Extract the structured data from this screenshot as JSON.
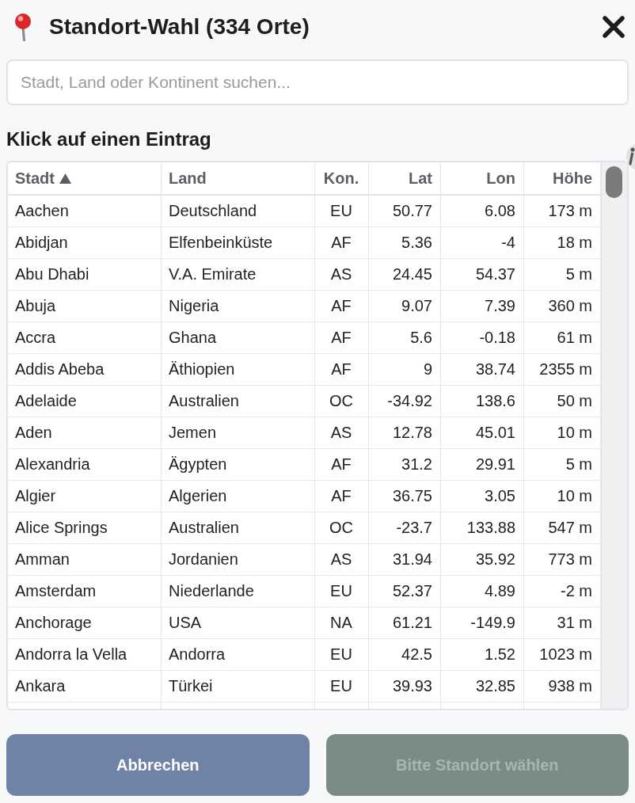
{
  "dialog": {
    "title": "Standort-Wahl (334 Orte)"
  },
  "search": {
    "placeholder": "Stadt, Land oder Kontinent suchen..."
  },
  "list_heading": "Klick auf einen Eintrag",
  "table": {
    "columns": [
      {
        "label": "Stadt",
        "kind": "text",
        "sorted": true
      },
      {
        "label": "Land",
        "kind": "text",
        "sorted": false
      },
      {
        "label": "Kon.",
        "kind": "code",
        "sorted": false
      },
      {
        "label": "Lat",
        "kind": "number",
        "sorted": false
      },
      {
        "label": "Lon",
        "kind": "number",
        "sorted": false
      },
      {
        "label": "Höhe",
        "kind": "number",
        "sorted": false
      }
    ],
    "rows": [
      [
        "Aachen",
        "Deutschland",
        "EU",
        "50.77",
        "6.08",
        "173 m"
      ],
      [
        "Abidjan",
        "Elfenbeinküste",
        "AF",
        "5.36",
        "-4",
        "18 m"
      ],
      [
        "Abu Dhabi",
        "V.A. Emirate",
        "AS",
        "24.45",
        "54.37",
        "5 m"
      ],
      [
        "Abuja",
        "Nigeria",
        "AF",
        "9.07",
        "7.39",
        "360 m"
      ],
      [
        "Accra",
        "Ghana",
        "AF",
        "5.6",
        "-0.18",
        "61 m"
      ],
      [
        "Addis Abeba",
        "Äthiopien",
        "AF",
        "9",
        "38.74",
        "2355 m"
      ],
      [
        "Adelaide",
        "Australien",
        "OC",
        "-34.92",
        "138.6",
        "50 m"
      ],
      [
        "Aden",
        "Jemen",
        "AS",
        "12.78",
        "45.01",
        "10 m"
      ],
      [
        "Alexandria",
        "Ägypten",
        "AF",
        "31.2",
        "29.91",
        "5 m"
      ],
      [
        "Algier",
        "Algerien",
        "AF",
        "36.75",
        "3.05",
        "10 m"
      ],
      [
        "Alice Springs",
        "Australien",
        "OC",
        "-23.7",
        "133.88",
        "547 m"
      ],
      [
        "Amman",
        "Jordanien",
        "AS",
        "31.94",
        "35.92",
        "773 m"
      ],
      [
        "Amsterdam",
        "Niederlande",
        "EU",
        "52.37",
        "4.89",
        "-2 m"
      ],
      [
        "Anchorage",
        "USA",
        "NA",
        "61.21",
        "-149.9",
        "31 m"
      ],
      [
        "Andorra la Vella",
        "Andorra",
        "EU",
        "42.5",
        "1.52",
        "1023 m"
      ],
      [
        "Ankara",
        "Türkei",
        "EU",
        "39.93",
        "32.85",
        "938 m"
      ]
    ]
  },
  "buttons": [
    {
      "label": "Abbrechen",
      "kind": "secondary",
      "disabled": false
    },
    {
      "label": "Bitte Standort wählen",
      "kind": "primary",
      "disabled": true
    }
  ]
}
